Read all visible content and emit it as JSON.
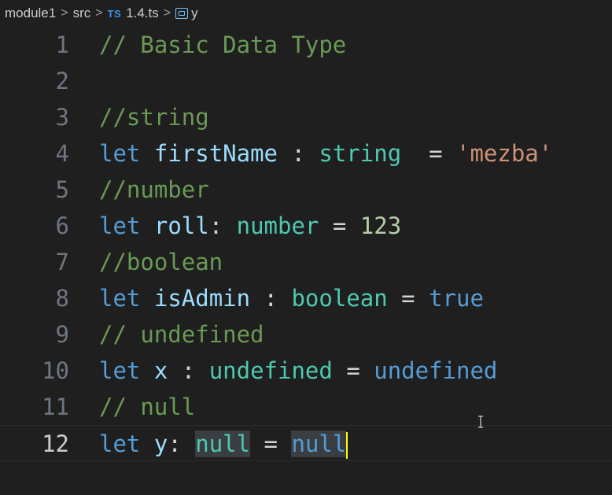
{
  "breadcrumb": {
    "items": [
      "module1",
      "src",
      "1.4.ts",
      "y"
    ],
    "ts_badge": "TS",
    "separator": ">"
  },
  "colors": {
    "background": "#1f1f1f",
    "comment": "#6a9955",
    "keyword": "#569cd6",
    "variable": "#9cdcfe",
    "type": "#4ec9b0",
    "string": "#ce9178",
    "number": "#b5cea8",
    "cursor": "#ffff00"
  },
  "editor": {
    "active_line": 12,
    "lines": [
      {
        "n": "1",
        "tokens": [
          {
            "t": "// Basic Data Type",
            "c": "comment"
          }
        ]
      },
      {
        "n": "2",
        "tokens": []
      },
      {
        "n": "3",
        "tokens": [
          {
            "t": "//string",
            "c": "comment"
          }
        ]
      },
      {
        "n": "4",
        "tokens": [
          {
            "t": "let",
            "c": "kw"
          },
          {
            "t": " ",
            "c": "punc"
          },
          {
            "t": "firstName",
            "c": "var"
          },
          {
            "t": " : ",
            "c": "punc"
          },
          {
            "t": "string",
            "c": "type"
          },
          {
            "t": "  = ",
            "c": "punc"
          },
          {
            "t": "'mezba'",
            "c": "str"
          }
        ]
      },
      {
        "n": "5",
        "tokens": [
          {
            "t": "//number",
            "c": "comment"
          }
        ]
      },
      {
        "n": "6",
        "tokens": [
          {
            "t": "let",
            "c": "kw"
          },
          {
            "t": " ",
            "c": "punc"
          },
          {
            "t": "roll",
            "c": "var"
          },
          {
            "t": ": ",
            "c": "punc"
          },
          {
            "t": "number",
            "c": "type"
          },
          {
            "t": " = ",
            "c": "punc"
          },
          {
            "t": "123",
            "c": "num"
          }
        ]
      },
      {
        "n": "7",
        "tokens": [
          {
            "t": "//boolean",
            "c": "comment"
          }
        ]
      },
      {
        "n": "8",
        "tokens": [
          {
            "t": "let",
            "c": "kw"
          },
          {
            "t": " ",
            "c": "punc"
          },
          {
            "t": "isAdmin",
            "c": "var"
          },
          {
            "t": " : ",
            "c": "punc"
          },
          {
            "t": "boolean",
            "c": "type"
          },
          {
            "t": " = ",
            "c": "punc"
          },
          {
            "t": "true",
            "c": "kw"
          }
        ]
      },
      {
        "n": "9",
        "tokens": [
          {
            "t": "// undefined",
            "c": "comment"
          }
        ]
      },
      {
        "n": "10",
        "tokens": [
          {
            "t": "let",
            "c": "kw"
          },
          {
            "t": " ",
            "c": "punc"
          },
          {
            "t": "x",
            "c": "var"
          },
          {
            "t": " : ",
            "c": "punc"
          },
          {
            "t": "undefined",
            "c": "type"
          },
          {
            "t": " = ",
            "c": "punc"
          },
          {
            "t": "undefined",
            "c": "kw"
          }
        ]
      },
      {
        "n": "11",
        "tokens": [
          {
            "t": "// null",
            "c": "comment"
          }
        ]
      },
      {
        "n": "12",
        "tokens": [
          {
            "t": "let",
            "c": "kw"
          },
          {
            "t": " ",
            "c": "punc"
          },
          {
            "t": "y",
            "c": "var"
          },
          {
            "t": ": ",
            "c": "punc"
          },
          {
            "t": "null",
            "c": "type",
            "hl": true
          },
          {
            "t": " = ",
            "c": "punc"
          },
          {
            "t": "null",
            "c": "kw",
            "hl": true
          }
        ]
      }
    ]
  }
}
